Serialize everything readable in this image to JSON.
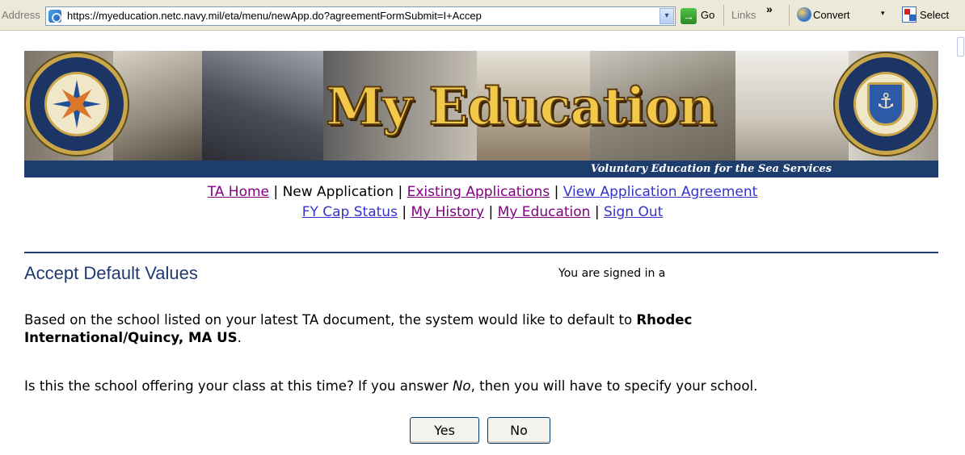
{
  "browser": {
    "address_label": "Address",
    "url": "https://myeducation.netc.navy.mil/eta/menu/newApp.do?agreementFormSubmit=I+Accep",
    "go_label": "Go",
    "links_label": "Links",
    "chevron": "»",
    "convert_label": "Convert",
    "convert_caret": "▾",
    "select_label": "Select",
    "dropdown_arrow": "▾",
    "go_arrow": "→"
  },
  "banner": {
    "title": "My Education",
    "tagline": "Voluntary Education for the Sea Services"
  },
  "nav": {
    "row1": [
      {
        "label": "TA Home",
        "type": "link",
        "visited": true
      },
      {
        "label": "New Application",
        "type": "current"
      },
      {
        "label": "Existing Applications",
        "type": "link",
        "visited": true
      },
      {
        "label": "View Application Agreement",
        "type": "link",
        "visited": false
      }
    ],
    "row2": [
      {
        "label": "FY Cap Status",
        "type": "link",
        "visited": false
      },
      {
        "label": "My History",
        "type": "link",
        "visited": true
      },
      {
        "label": "My Education",
        "type": "link",
        "visited": true
      },
      {
        "label": "Sign Out",
        "type": "link",
        "visited": false
      }
    ],
    "separator": "|"
  },
  "main": {
    "heading": "Accept Default Values",
    "signed_in": "You are signed in a",
    "para1_text": "Based on the school listed on your latest TA document, the system would like to default to ",
    "para1_bold": "Rhodec",
    "para2_bold": "International/Quincy, MA US",
    "para2_end": ".",
    "para3_before": "Is this the school offering your class at this time? If you answer ",
    "para3_italic": "No",
    "para3_after": ", then you will have to specify your school.",
    "yes_label": "Yes",
    "no_label": "No"
  },
  "colors": {
    "link": "#3333cc",
    "visited_link": "#800080",
    "heading": "#1f3a6e",
    "rule": "#1d3d6d",
    "banner_strip": "#1d3d6d",
    "title_gold": "#f2c84b"
  },
  "icons": {
    "page": "page-icon",
    "go": "go-arrow-icon",
    "convert": "convert-icon",
    "select": "select-icon"
  }
}
